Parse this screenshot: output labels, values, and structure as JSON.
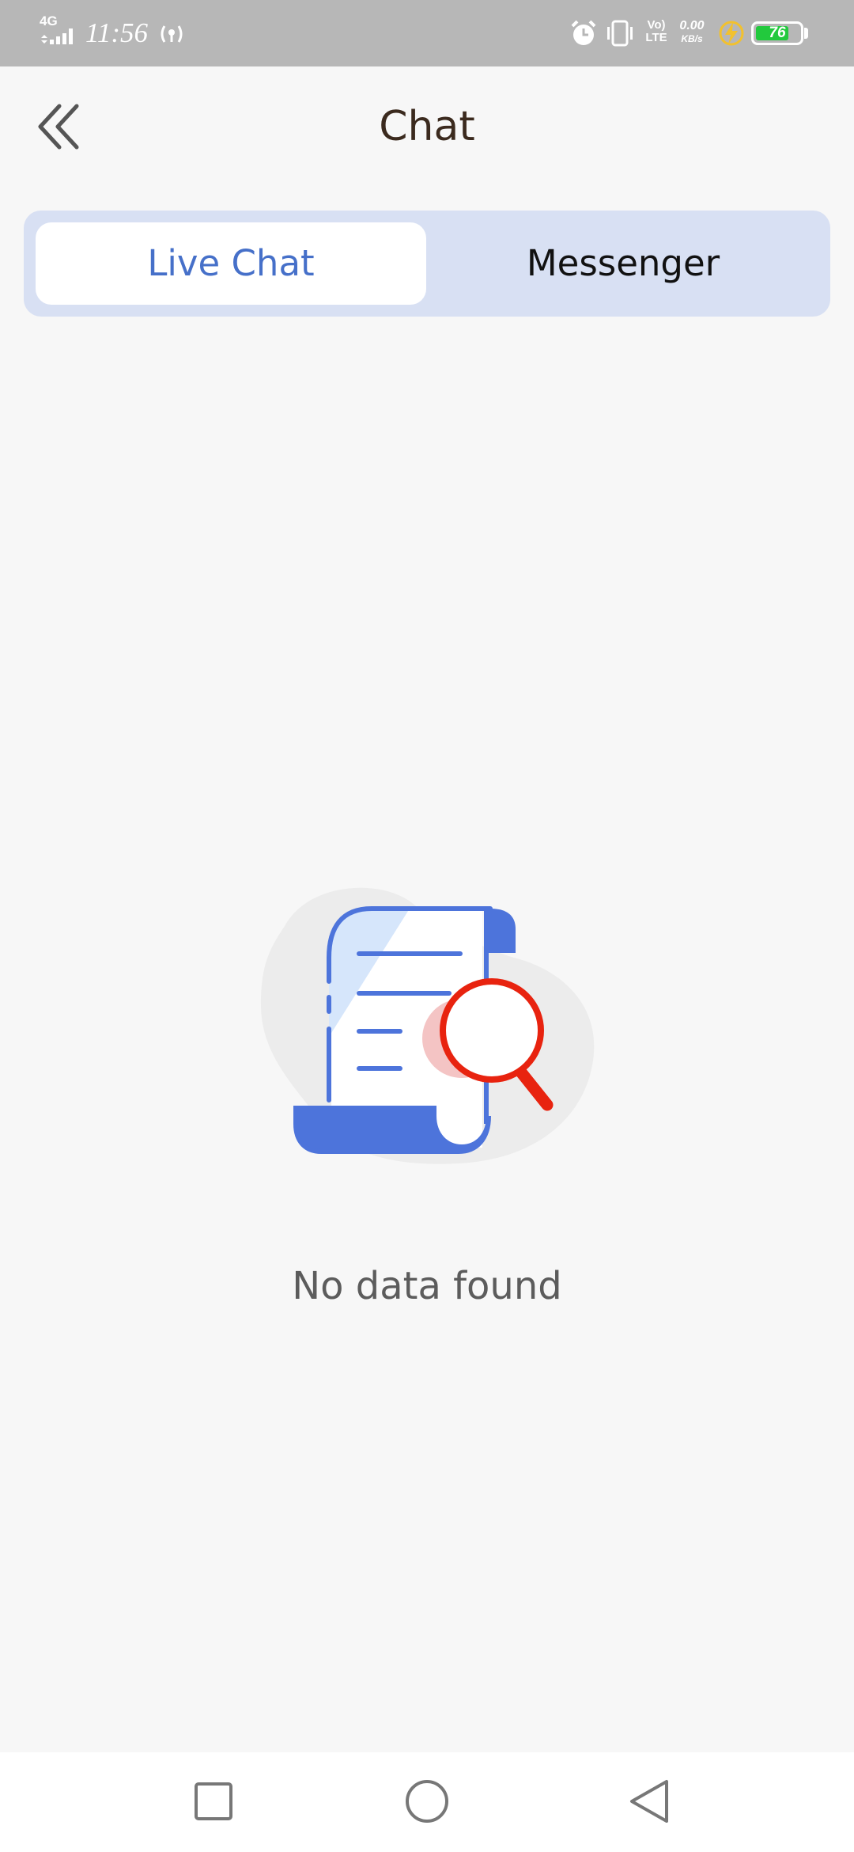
{
  "status_bar": {
    "network": "4G",
    "time": "11:56",
    "volte_line1": "Vo)",
    "volte_line2": "LTE",
    "speed_value": "0.00",
    "speed_unit": "KB/s",
    "battery_level": "76",
    "battery_fraction": 0.76,
    "icons": [
      "signal-icon",
      "hotspot-icon",
      "alarm-icon",
      "vibrate-icon",
      "charging-icon",
      "battery-icon"
    ]
  },
  "header": {
    "title": "Chat",
    "back_icon": "double-chevron-left-icon"
  },
  "tabs": [
    {
      "label": "Live Chat",
      "selected": true
    },
    {
      "label": "Messenger",
      "selected": false
    }
  ],
  "empty_state": {
    "illustration": "document-search-illustration",
    "message": "No data found"
  },
  "nav_bar": {
    "buttons": [
      "recent-apps-icon",
      "home-icon",
      "back-icon"
    ]
  },
  "colors": {
    "accent": "#4670c9",
    "tab_bar_bg": "#d8e0f3",
    "illustration_blue": "#4d74db",
    "illustration_red": "#e8230f",
    "battery_green": "#22c93d"
  }
}
